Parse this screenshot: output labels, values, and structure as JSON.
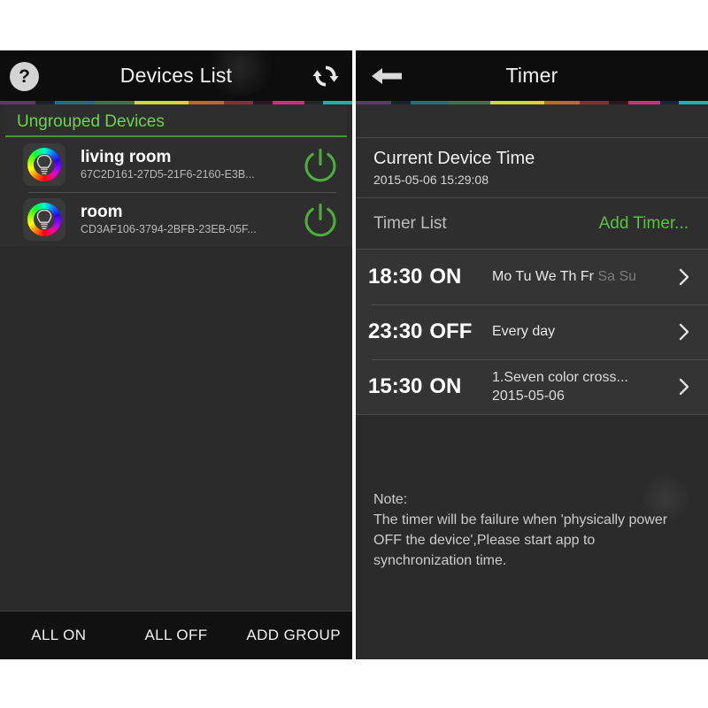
{
  "theme": {
    "accent_green": "#6fd44a",
    "add_timer_green": "#58c440",
    "panel_bg": "#2e2e2e",
    "titlebar_bg": "#0d0d0d",
    "text_primary": "#ffffff",
    "text_secondary": "#b9b9b9",
    "text_dim": "#7c7c7c"
  },
  "rainbow_segments": [
    {
      "color": "#6b2f78",
      "width": 11
    },
    {
      "color": "#1b1f2e",
      "width": 6
    },
    {
      "color": "#1f6f86",
      "width": 12
    },
    {
      "color": "#2f7a4a",
      "width": 13
    },
    {
      "color": "#d8cf3a",
      "width": 17
    },
    {
      "color": "#c2622e",
      "width": 11
    },
    {
      "color": "#8e2f26",
      "width": 9
    },
    {
      "color": "#2a1620",
      "width": 6
    },
    {
      "color": "#c42f8c",
      "width": 10
    },
    {
      "color": "#1d2438",
      "width": 6
    },
    {
      "color": "#2aa7b5",
      "width": 9
    }
  ],
  "left_panel": {
    "titlebar": {
      "title": "Devices List",
      "help_icon": "question-mark-icon",
      "help_glyph": "?",
      "refresh_icon": "refresh-sync-icon"
    },
    "group": {
      "header": "Ungrouped Devices"
    },
    "devices": [
      {
        "name": "living room",
        "id": "67C2D161-27D5-21F6-2160-E3B...",
        "icon": "rgb-bulb-icon",
        "power_icon": "power-toggle-icon",
        "power_state": "on"
      },
      {
        "name": "room",
        "id": "CD3AF106-3794-2BFB-23EB-05F...",
        "icon": "rgb-bulb-icon",
        "power_icon": "power-toggle-icon",
        "power_state": "on"
      }
    ],
    "bottom_bar": {
      "all_on": "ALL ON",
      "all_off": "ALL OFF",
      "add_group": "ADD GROUP"
    }
  },
  "right_panel": {
    "titlebar": {
      "title": "Timer",
      "back_icon": "back-arrow-icon"
    },
    "current_device_time": {
      "label": "Current Device Time",
      "value": "2015-05-06 15:29:08"
    },
    "timer_list": {
      "label": "Timer List",
      "add_label": "Add Timer..."
    },
    "timers": [
      {
        "time": "18:30",
        "action": "ON",
        "days_active": "Mo Tu We Th Fr",
        "days_inactive": "Sa Su",
        "sub": "",
        "chevron": "chevron-right-icon"
      },
      {
        "time": "23:30",
        "action": "OFF",
        "days_active": "Every day",
        "days_inactive": "",
        "sub": "",
        "chevron": "chevron-right-icon"
      },
      {
        "time": "15:30",
        "action": "ON",
        "days_active": "1.Seven color cross...",
        "days_inactive": "",
        "sub": "2015-05-06",
        "chevron": "chevron-right-icon"
      }
    ],
    "note": {
      "line1": "Note:",
      "line2": "The timer will be failure when 'physically power",
      "line3": "OFF the device',Please start app to",
      "line4": "synchronization time."
    }
  }
}
